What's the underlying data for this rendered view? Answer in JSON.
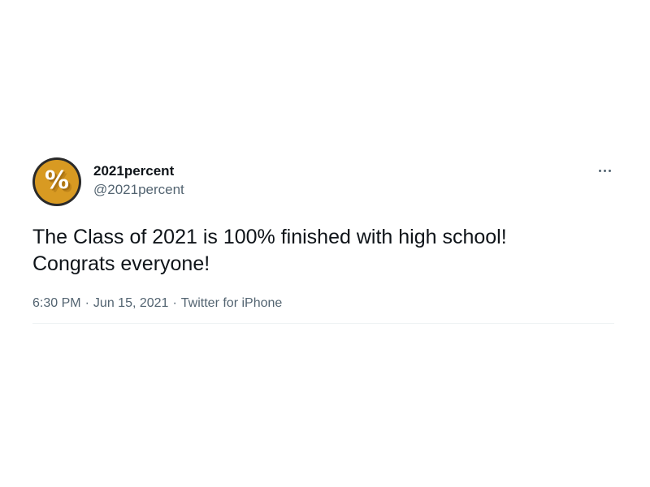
{
  "tweet": {
    "author": {
      "display_name": "2021percent",
      "handle": "@2021percent",
      "avatar_glyph": "%",
      "avatar_color": "#d89a22"
    },
    "more_icon": "more-horizontal-icon",
    "text": "The Class of 2021 is 100% finished with high school!\nCongrats everyone!",
    "meta": {
      "time": "6:30 PM",
      "separator": "·",
      "date": "Jun 15, 2021",
      "source": "Twitter for iPhone"
    }
  },
  "colors": {
    "primary_text": "#0f1419",
    "secondary_text": "#536471",
    "divider": "#eff3f4"
  }
}
